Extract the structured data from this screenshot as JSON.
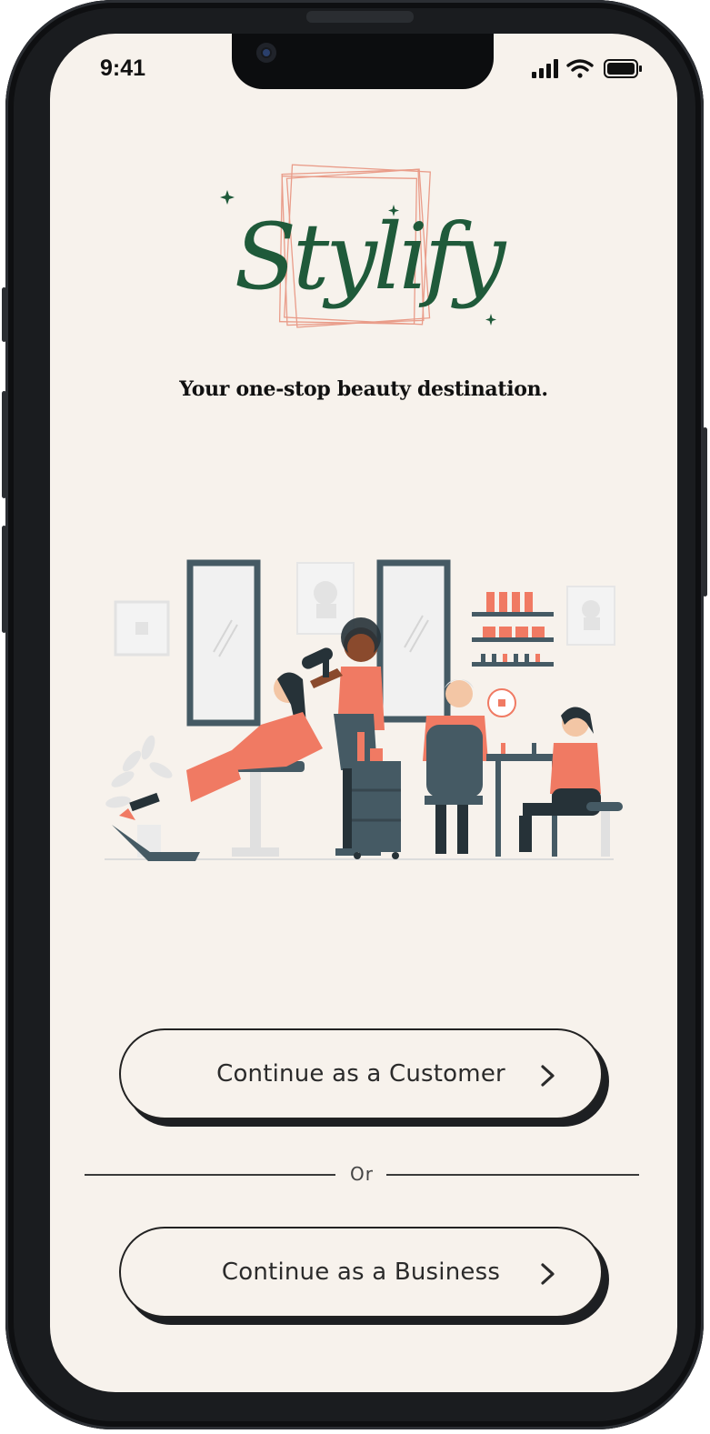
{
  "status_bar": {
    "time": "9:41",
    "icons": [
      "cellular-signal-icon",
      "wifi-icon",
      "battery-icon"
    ]
  },
  "brand": {
    "logo_text": "Stylify",
    "tagline": "Your one-stop beauty destination.",
    "colors": {
      "logo_green": "#1f5a3a",
      "accent_coral": "#f07a63",
      "background": "#f7f2ec",
      "dark_slate": "#455a64"
    }
  },
  "illustration": {
    "subject": "salon-scene-illustration"
  },
  "actions": {
    "customer_label": "Continue as a Customer",
    "divider_label": "Or",
    "business_label": "Continue as a Business"
  }
}
